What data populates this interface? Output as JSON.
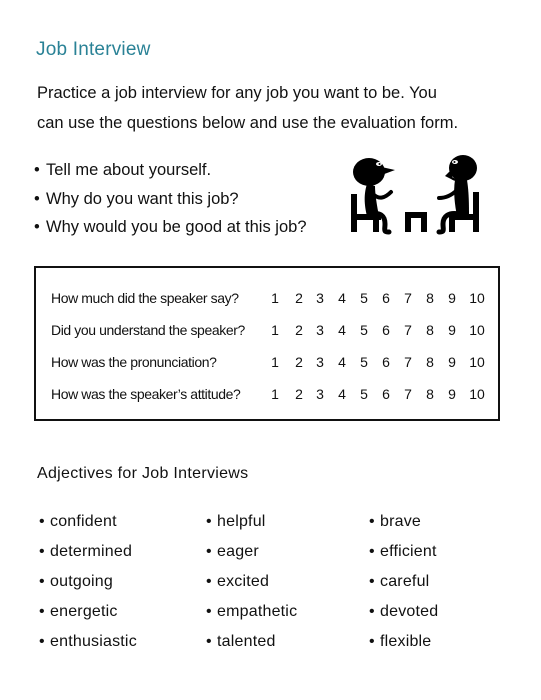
{
  "title": "Job Interview",
  "intro": {
    "line1": "Practice a job interview for any job you want to be.  You",
    "line2": "can use the questions below and use the evaluation form."
  },
  "questions": [
    "Tell me about yourself.",
    "Why do you want this job?",
    "Why would you be good at this job?"
  ],
  "illustration": {
    "icon": "interview-people-icon",
    "description": "Two silhouette figures sitting on chairs facing each other across a small table"
  },
  "evaluation": {
    "rows": [
      {
        "question": "How much did the speaker say?"
      },
      {
        "question": "Did you understand the speaker?"
      },
      {
        "question": "How was the pronunciation?"
      },
      {
        "question": "How was the speaker’s attitude?"
      }
    ],
    "scale": [
      "1",
      "2",
      "3",
      "4",
      "5",
      "6",
      "7",
      "8",
      "9",
      "10"
    ]
  },
  "adjectives": {
    "title": "Adjectives for Job Interviews",
    "columns": [
      [
        "confident",
        "determined",
        "outgoing",
        "energetic",
        "enthusiastic"
      ],
      [
        "helpful",
        "eager",
        "excited",
        "empathetic",
        "talented"
      ],
      [
        "brave",
        "efficient",
        "careful",
        "devoted",
        "flexible"
      ]
    ]
  },
  "bullet": "•",
  "colors": {
    "title": "#2a8296",
    "text": "#111111",
    "border": "#111111"
  }
}
